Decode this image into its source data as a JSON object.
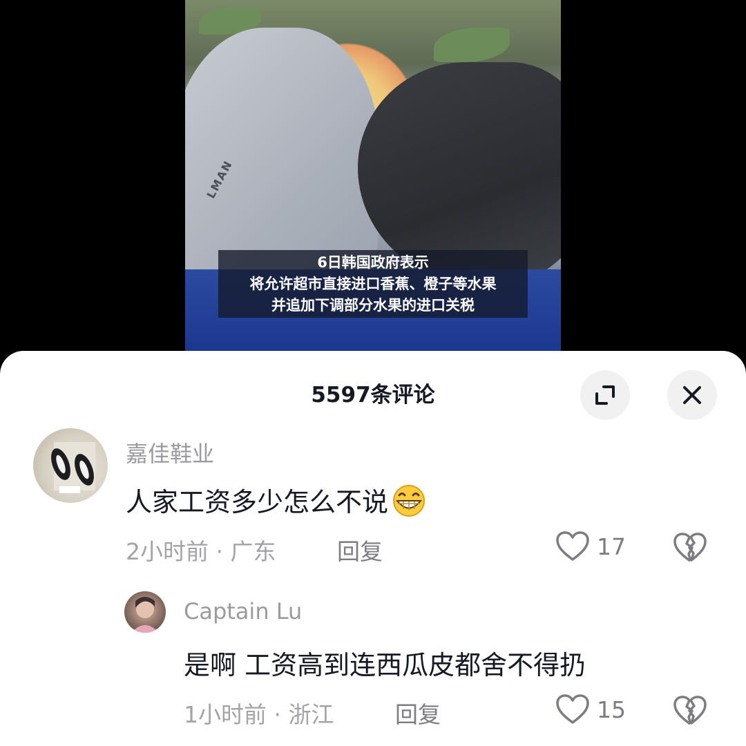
{
  "video": {
    "caption_lines": [
      "6日韩国政府表示",
      "将允许超市直接进口香蕉、橙子等水果",
      "并追加下调部分水果的进口关税"
    ],
    "glove_text": "LMAN"
  },
  "sheet": {
    "title": "5597条评论",
    "expand_icon": "expand-icon",
    "close_icon": "close-icon"
  },
  "comments": [
    {
      "username": "嘉佳鞋业",
      "text": "人家工资多少怎么不说",
      "emoji": "grinning-face-emoji",
      "time": "2小时前",
      "location": "广东",
      "meta_sep": "·",
      "reply_label": "回复",
      "like_count": "17"
    },
    {
      "username": "Captain Lu",
      "text": "是啊 工资高到连西瓜皮都舍不得扔",
      "time": "1小时前",
      "location": "浙江",
      "meta_sep": "·",
      "reply_label": "回复",
      "like_count": "15"
    }
  ]
}
